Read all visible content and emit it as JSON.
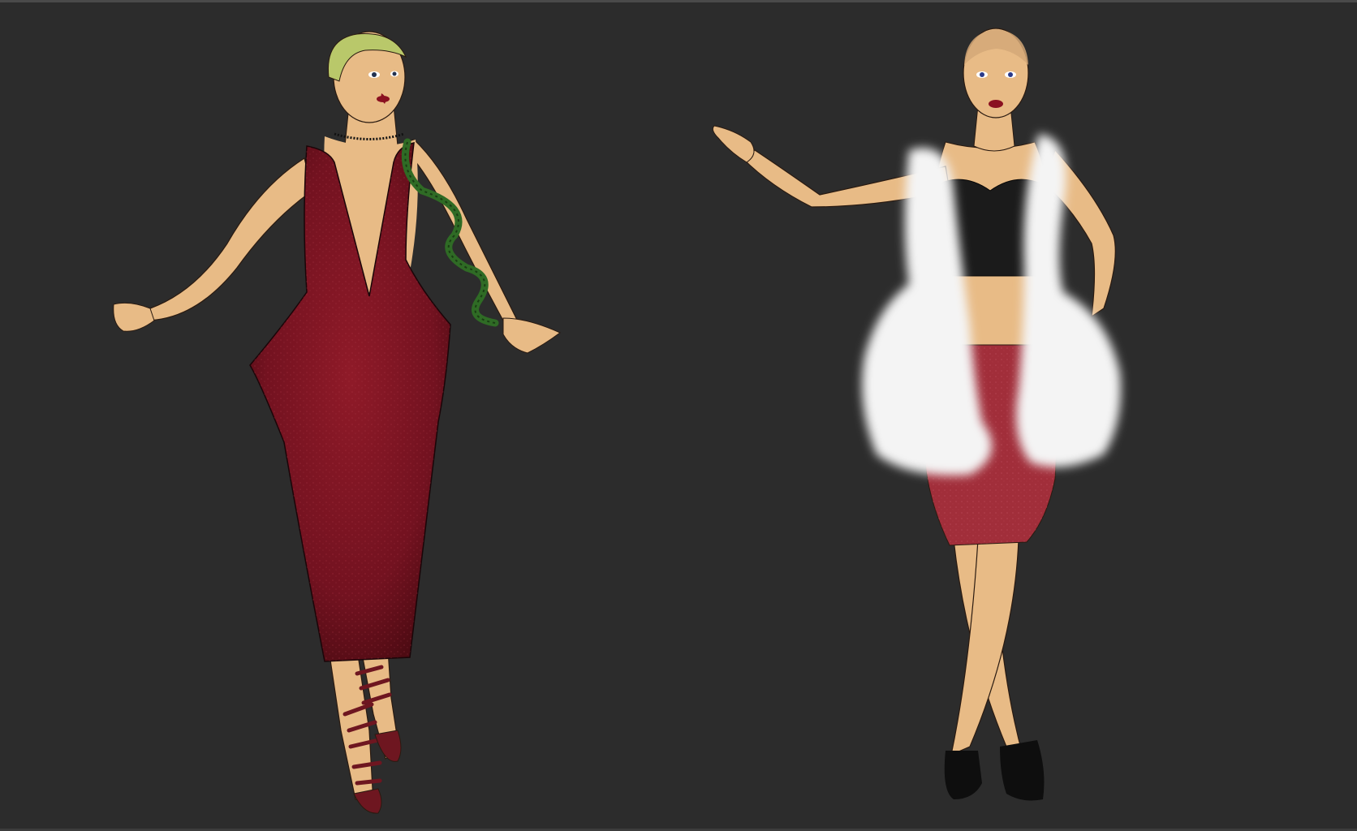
{
  "scene": {
    "background": "#2c2c2c",
    "figures": [
      {
        "id": "figure-left",
        "garment": "dress",
        "colors": {
          "skin": "#e8bb86",
          "hair": "#b9c86a",
          "dress": "#7a1320",
          "dress_shadow": "#4e0b13",
          "snake": "#2f6b25",
          "shoes": "#6e1620",
          "lips": "#8a1020"
        }
      },
      {
        "id": "figure-right",
        "garment": "fur-vest-and-skirt",
        "colors": {
          "skin": "#e8bb86",
          "hair": "#d4a878",
          "top": "#1b1b1b",
          "fur": "#f4f4f4",
          "skirt": "#a12e3a",
          "skirt_shadow": "#7c1f2a",
          "shoes": "#0e0e0e",
          "lips": "#8a1020"
        }
      }
    ]
  }
}
